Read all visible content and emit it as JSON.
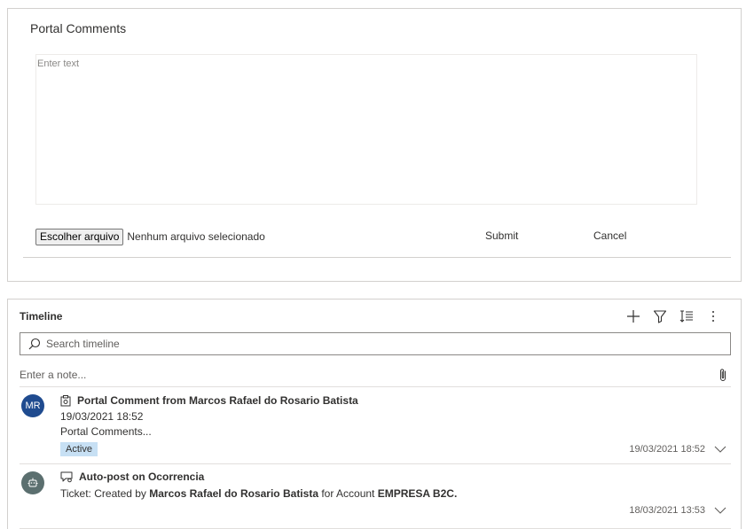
{
  "portal_comments": {
    "title": "Portal Comments",
    "textarea_placeholder": "Enter text",
    "file_button_label": "Escolher arquivo",
    "file_status": "Nenhum arquivo selecionado",
    "submit_label": "Submit",
    "cancel_label": "Cancel"
  },
  "timeline": {
    "title": "Timeline",
    "tools": [
      "add-icon",
      "filter-icon",
      "sort-icon",
      "more-icon"
    ],
    "search_placeholder": "Search timeline",
    "note_placeholder": "Enter a note...",
    "posts": [
      {
        "avatar_initials": "MR",
        "avatar_color": "#1f4b8f",
        "icon": "portal-comment-icon",
        "title": "Portal Comment from Marcos Rafael do Rosario Batista",
        "date": "19/03/2021 18:52",
        "body": "Portal Comments...",
        "status": "Active",
        "timestamp": "19/03/2021 18:52"
      },
      {
        "avatar_icon": "bot-icon",
        "avatar_color": "#5b6f6f",
        "icon": "auto-post-icon",
        "title": "Auto-post on Ocorrencia",
        "body_prefix": "Ticket: Created by ",
        "body_user": "Marcos Rafael do Rosario Batista",
        "body_middle": " for Account ",
        "body_account": "EMPRESA B2C.",
        "timestamp": "18/03/2021 13:53"
      }
    ]
  }
}
